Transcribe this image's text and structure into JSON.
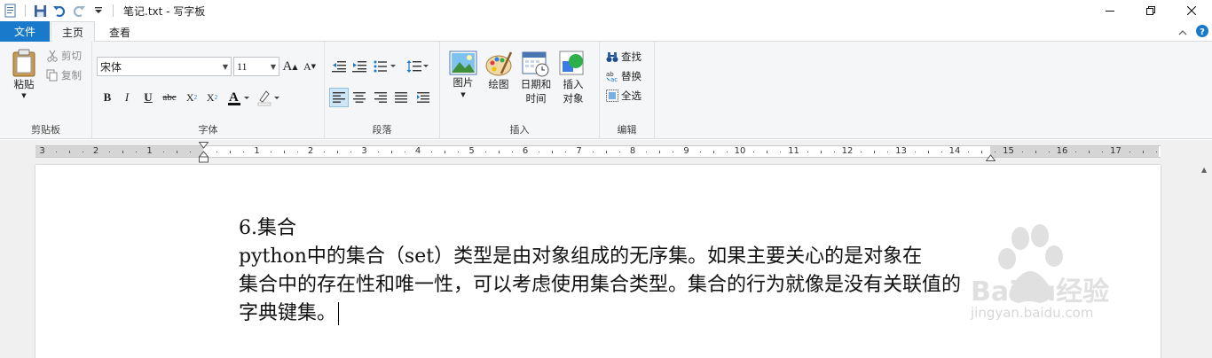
{
  "window": {
    "title": "笔记.txt - 写字板"
  },
  "tabs": {
    "file": "文件",
    "home": "主页",
    "view": "查看"
  },
  "clipboard": {
    "label": "剪贴板",
    "paste": "粘贴",
    "cut": "剪切",
    "copy": "复制"
  },
  "font": {
    "label": "字体",
    "family": "宋体",
    "size": "11"
  },
  "paragraph": {
    "label": "段落"
  },
  "insert": {
    "label": "插入",
    "picture": "图片",
    "paint": "绘图",
    "datetime_1": "日期和",
    "datetime_2": "时间",
    "object_1": "插入",
    "object_2": "对象"
  },
  "editing": {
    "label": "编辑",
    "find": "查找",
    "replace": "替换",
    "select_all": "全选"
  },
  "ruler": {
    "numbers": [
      "3",
      "2",
      "1",
      "1",
      "2",
      "3",
      "4",
      "5",
      "6",
      "7",
      "8",
      "9",
      "10",
      "11",
      "12",
      "13",
      "14",
      "15",
      "16",
      "17"
    ]
  },
  "document": {
    "lines": [
      "6.集合",
      "        python中的集合（set）类型是由对象组成的无序集。如果主要关心的是对象在",
      "集合中的存在性和唯一性，可以考虑使用集合类型。集合的行为就像是没有关联值的",
      "字典键集。"
    ]
  },
  "watermark": {
    "brand": "Baidu经验",
    "url": "jingyan.baidu.com"
  },
  "colors": {
    "file_tab": "#1979ca",
    "ribbon_bg": "#f5f6f7",
    "workspace": "#f0f0f0",
    "accent_blue": "#1979ca"
  }
}
